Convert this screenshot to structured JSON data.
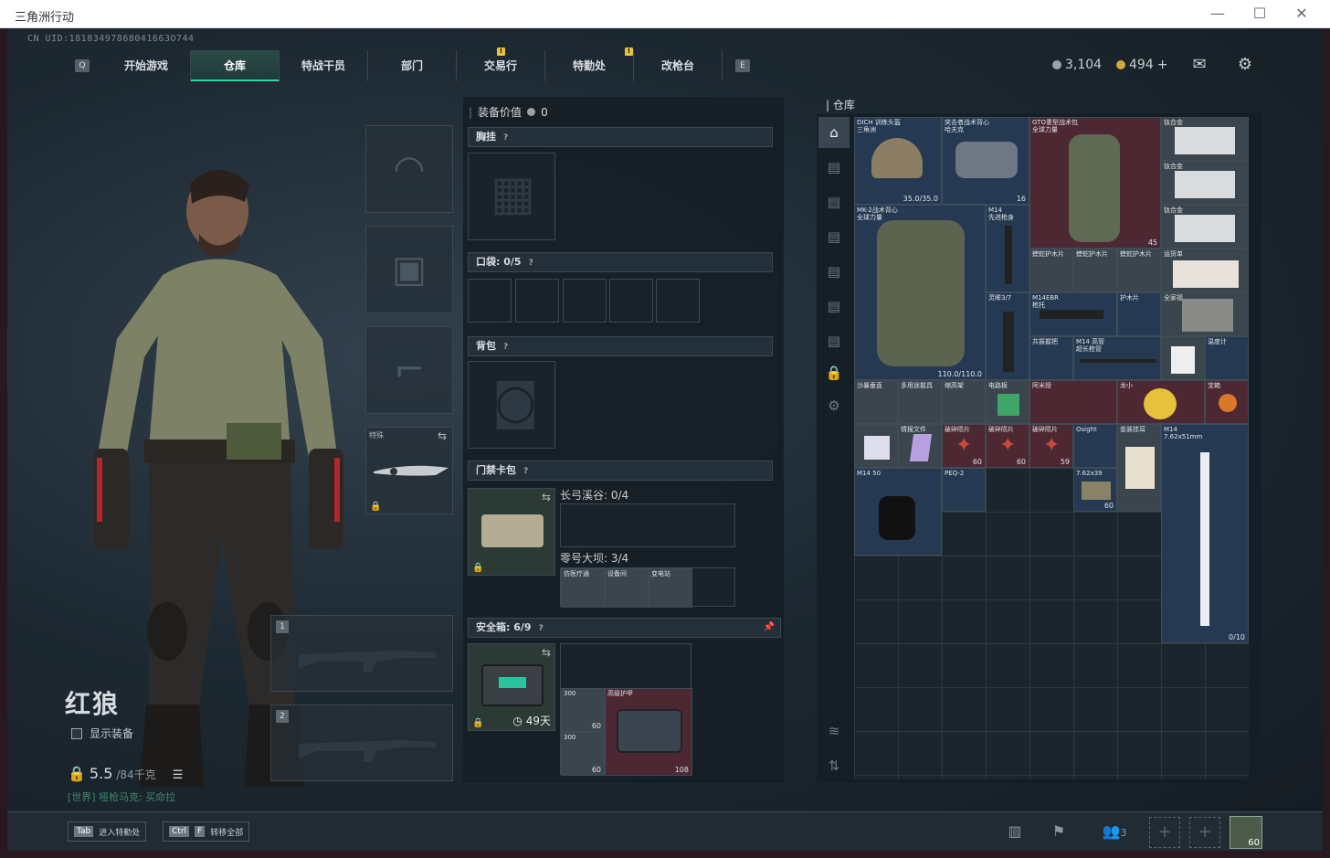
{
  "window": {
    "title": "三角洲行动",
    "minimize": "—",
    "maximize": "☐",
    "close": "✕"
  },
  "uid": "CN UID:18183497868041663O744",
  "nav": {
    "key_left": "Q",
    "key_right": "E",
    "tabs": [
      {
        "label": "开始游戏",
        "active": false
      },
      {
        "label": "仓库",
        "active": true
      },
      {
        "label": "特战干员",
        "active": false
      },
      {
        "label": "部门",
        "active": false
      },
      {
        "label": "交易行",
        "active": false,
        "badge": "!"
      },
      {
        "label": "特勤处",
        "active": false
      },
      {
        "label": "改枪台",
        "active": false,
        "badge": "!"
      }
    ]
  },
  "currency": {
    "silver": "3,104",
    "gold": "494",
    "gold_plus": "+"
  },
  "icons": {
    "mail": "mail-icon",
    "settings": "gear-icon"
  },
  "character": {
    "name": "红狼",
    "show_equipment": "显示装备",
    "weight": "5.5",
    "weight_max": "/84千克",
    "chat": "[世界] 哑枪马克: 买命拉"
  },
  "slots": {
    "melee_label": "特殊",
    "weapon1": "1",
    "weapon2": "2"
  },
  "mid": {
    "equip_value_label": "装备价值",
    "equip_value": "0",
    "chest_rig": "胸挂",
    "pockets": "口袋: 0/5",
    "backpack": "背包",
    "keycard": "门禁卡包",
    "key_a": "长弓溪谷: 0/4",
    "key_b": "零号大坝: 3/4",
    "key_items": [
      "仿医疗通",
      "设备间",
      "变电站"
    ],
    "safebox": "安全箱: 6/9",
    "safebox_time": "49天",
    "safe_items": [
      {
        "label": "",
        "count": "300",
        "sub": "60"
      },
      {
        "label": "",
        "count": "300",
        "sub": "60"
      },
      {
        "label": "高级护甲",
        "count": "108"
      }
    ],
    "help": "?"
  },
  "warehouse": {
    "title": "仓库",
    "items": [
      {
        "label": "DICH 训练头盔\n三角洲",
        "count": "35.0/35.0",
        "color": "blue"
      },
      {
        "label": "突击者战术背心\n哈夫克",
        "count": "16",
        "color": "blue"
      },
      {
        "label": "GTO重型战术包\n全球力量",
        "count": "45",
        "color": "red"
      },
      {
        "label": "钛合金",
        "count": "",
        "color": "gray"
      },
      {
        "label": "钛合金",
        "count": "",
        "color": "gray"
      },
      {
        "label": "钛合金",
        "count": "",
        "color": "gray"
      },
      {
        "label": "MK-2战术背心\n全球力量",
        "count": "110.0/110.0",
        "color": "blue"
      },
      {
        "label": "M14\n先进枪身",
        "count": "",
        "color": "blue"
      },
      {
        "label": "蝰蛇护木片",
        "count": "",
        "color": "gray"
      },
      {
        "label": "蝰蛇护木片",
        "count": "",
        "color": "gray"
      },
      {
        "label": "蝰蛇护木片",
        "count": "",
        "color": "gray"
      },
      {
        "label": "运货单",
        "count": "",
        "color": "gray"
      },
      {
        "label": "灵眸3/7",
        "count": "",
        "color": "blue"
      },
      {
        "label": "M14EBR\n枪托",
        "count": "",
        "color": "blue"
      },
      {
        "label": "护木片",
        "count": "",
        "color": "blue"
      },
      {
        "label": "全家福",
        "count": "",
        "color": "gray"
      },
      {
        "label": "共振握把",
        "count": "",
        "color": "blue"
      },
      {
        "label": "M14 高管\n超长枪管",
        "count": "",
        "color": "blue"
      },
      {
        "label": "",
        "count": "",
        "color": "gray"
      },
      {
        "label": "温度计",
        "count": "",
        "color": "blue"
      },
      {
        "label": "沙暴垂直",
        "count": "",
        "color": "gray"
      },
      {
        "label": "多用途握具",
        "count": "",
        "color": "gray"
      },
      {
        "label": "缩高架",
        "count": "",
        "color": "gray"
      },
      {
        "label": "电路板",
        "count": "",
        "color": "gray"
      },
      {
        "label": "阿米娅",
        "count": "",
        "color": "red"
      },
      {
        "label": "龙小",
        "count": "",
        "color": "red"
      },
      {
        "label": "宝箱",
        "count": "",
        "color": "red"
      },
      {
        "label": "",
        "count": "",
        "color": "orange"
      },
      {
        "label": "情报文件",
        "count": "",
        "color": "gray"
      },
      {
        "label": "破碎陨片",
        "count": "60",
        "color": "red"
      },
      {
        "label": "破碎陨片",
        "count": "60",
        "color": "red"
      },
      {
        "label": "破碎陨片",
        "count": "59",
        "color": "red"
      },
      {
        "label": "Osight",
        "count": "",
        "color": "blue"
      },
      {
        "label": "金装挂耳",
        "count": "",
        "color": "gray"
      },
      {
        "label": "M14\n7.62x51mm",
        "count": "0/10",
        "color": "blue"
      },
      {
        "label": "M14 50",
        "count": "",
        "color": "blue"
      },
      {
        "label": "PEQ-2",
        "count": "",
        "color": "blue"
      },
      {
        "label": "7.62x39",
        "count": "60",
        "color": "blue"
      }
    ]
  },
  "bottom": {
    "key1": "Tab",
    "key1_label": "进入特勤处",
    "key2a": "Ctrl",
    "key2b": "F",
    "key2_label": "转移全部",
    "party": "3",
    "level": "60"
  }
}
